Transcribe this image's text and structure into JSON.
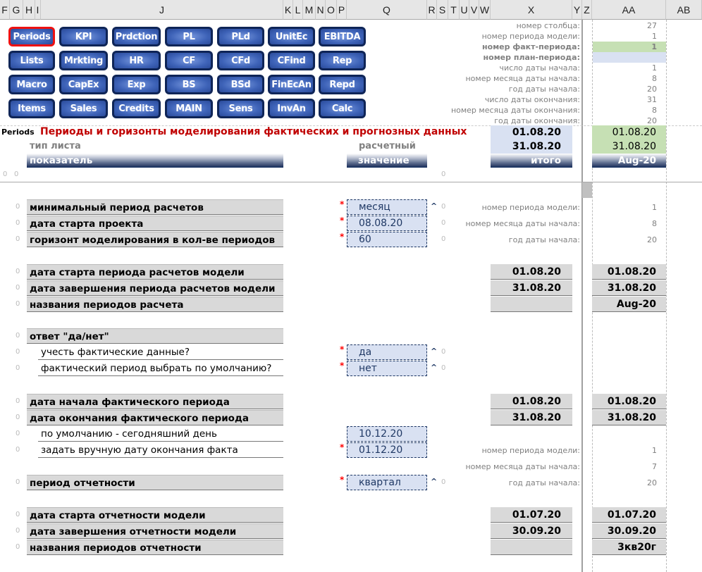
{
  "columns": [
    "F",
    "G",
    "H",
    "I",
    "J",
    "K",
    "L",
    "M",
    "N",
    "O",
    "P",
    "Q",
    "R",
    "S",
    "T",
    "U",
    "V",
    "W",
    "X",
    "Y",
    "Z",
    "AA",
    "AB"
  ],
  "nav_buttons": [
    [
      "Periods",
      "KPI",
      "Prdction",
      "PL",
      "PLd",
      "UnitEc",
      "EBITDA"
    ],
    [
      "Lists",
      "Mrkting",
      "HR",
      "CF",
      "CFd",
      "CFind",
      "Rep"
    ],
    [
      "Macro",
      "CapEx",
      "Exp",
      "BS",
      "BSd",
      "FinEcAn",
      "Repd"
    ],
    [
      "Items",
      "Sales",
      "Credits",
      "MAIN",
      "Sens",
      "InvAn",
      "Calc"
    ]
  ],
  "active_button": "Periods",
  "top_info": [
    {
      "label": "номер столбца:",
      "value": "27"
    },
    {
      "label": "номер периода модели:",
      "value": "1"
    },
    {
      "label": "номер факт-периода:",
      "value": "1",
      "bold": true,
      "highlight": "#c6e0b4"
    },
    {
      "label": "номер план-периода:",
      "value": "",
      "bold": true,
      "highlight": "#d9e1f2"
    },
    {
      "label": "число даты начала:",
      "value": "1"
    },
    {
      "label": "номер месяца даты начала:",
      "value": "8"
    },
    {
      "label": "год даты начала:",
      "value": "20"
    },
    {
      "label": "число даты окончания:",
      "value": "31"
    },
    {
      "label": "номер месяца даты окончания:",
      "value": "8"
    },
    {
      "label": "год даты окончания:",
      "value": "20"
    }
  ],
  "sheet": {
    "name": "Periods",
    "title": "Периоды и горизонты моделирования фактических и прогнозных данных",
    "sheet_type_label": "тип листа",
    "sheet_type_value": "расчетный",
    "header_indicator": "показатель",
    "header_value": "значение",
    "header_total": "итого",
    "header_period": "Aug-20",
    "total_start": "01.08.20",
    "total_end": "31.08.20",
    "period_start": "01.08.20",
    "period_end": "31.08.20",
    "zero": "0"
  },
  "rows": [
    {
      "label": "минимальный период расчетов",
      "bold": true,
      "star": true,
      "value": "месяц",
      "caret": true,
      "zero_right": true,
      "info_label": "номер периода модели:",
      "info_value": "1"
    },
    {
      "label": "дата старта проекта",
      "bold": true,
      "star": true,
      "value": "08.08.20",
      "zero_right": true,
      "info_label": "номер месяца даты начала:",
      "info_value": "8"
    },
    {
      "label": "горизонт моделирования в кол-ве периодов",
      "bold": true,
      "star": true,
      "value": "60",
      "zero_right": true,
      "info_label": "год даты начала:",
      "info_value": "20"
    },
    {
      "label": "дата старта периода расчетов модели",
      "bold": true,
      "x_value": "01.08.20",
      "aa_value": "01.08.20"
    },
    {
      "label": "дата завершения периода расчетов модели",
      "bold": true,
      "x_value": "31.08.20",
      "aa_value": "31.08.20"
    },
    {
      "label": "названия периодов расчета",
      "bold": true,
      "x_value": "",
      "aa_value": "Aug-20"
    },
    {
      "label": "ответ \"да/нет\"",
      "bold": true
    },
    {
      "label": "учесть фактические данные?",
      "indent": true,
      "star": true,
      "value": "да",
      "caret": true,
      "zero_right": true
    },
    {
      "label": "фактический период выбрать по умолчанию?",
      "indent": true,
      "star": true,
      "value": "нет",
      "caret": true,
      "zero_right": true
    },
    {
      "label": "дата начала фактического периода",
      "bold": true,
      "x_value": "01.08.20",
      "aa_value": "01.08.20"
    },
    {
      "label": "дата окончания фактического периода",
      "bold": true,
      "x_value": "31.08.20",
      "aa_value": "31.08.20"
    },
    {
      "label": "по умолчанию - сегодняшний день",
      "indent": true,
      "value": "10.12.20"
    },
    {
      "label": "задать вручную дату окончания факта",
      "indent": true,
      "star": true,
      "value": "01.12.20",
      "info_label": "номер периода модели:",
      "info_value": "1"
    },
    {
      "label": "период отчетности",
      "bold": true,
      "star": true,
      "value": "квартал",
      "caret": true,
      "zero_right": true,
      "info_label": "год даты начала:",
      "info_value": "20"
    },
    {
      "label": "дата старта отчетности модели",
      "bold": true,
      "x_value": "01.07.20",
      "aa_value": "01.07.20"
    },
    {
      "label": "дата завершения отчетности модели",
      "bold": true,
      "x_value": "30.09.20",
      "aa_value": "30.09.20"
    },
    {
      "label": "названия периодов отчетности",
      "bold": true,
      "x_value": "",
      "aa_value": "3кв20г"
    }
  ],
  "extra_info": {
    "label": "номер месяца даты начала:",
    "value": "7"
  },
  "markers": {
    "star": "*",
    "caret": "^"
  }
}
